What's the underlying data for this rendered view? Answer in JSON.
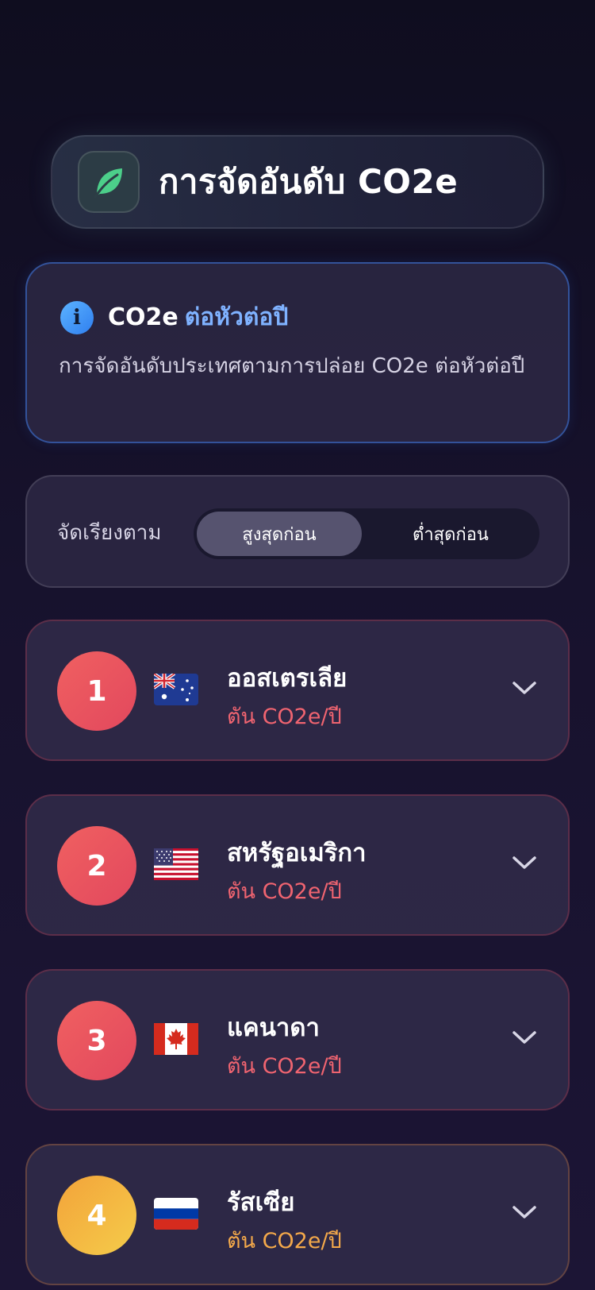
{
  "header": {
    "title": "การจัดอันดับ CO2e",
    "icon": "leaf-icon",
    "accent_color": "#4ccf8a"
  },
  "info": {
    "icon": "info-icon",
    "title_main": "CO2e",
    "title_sub": "ต่อหัวต่อปี",
    "description": "การจัดอันดับประเทศตามการปล่อย CO2e ต่อหัวต่อปี"
  },
  "sort": {
    "label": "จัดเรียงตาม",
    "options": [
      "สูงสุดก่อน",
      "ต่ำสุดก่อน"
    ],
    "selected": "สูงสุดก่อน"
  },
  "countries": [
    {
      "rank": "1",
      "name": "ออสเตรเลีย",
      "unit": "ตัน CO2e/ปี",
      "flag": "australia-flag",
      "color": "#ef5a64"
    },
    {
      "rank": "2",
      "name": "สหรัฐอเมริกา",
      "unit": "ตัน CO2e/ปี",
      "flag": "usa-flag",
      "color": "#ef5a64"
    },
    {
      "rank": "3",
      "name": "แคนาดา",
      "unit": "ตัน CO2e/ปี",
      "flag": "canada-flag",
      "color": "#ef5a64"
    },
    {
      "rank": "4",
      "name": "รัสเซีย",
      "unit": "ตัน CO2e/ปี",
      "flag": "russia-flag",
      "color": "#f4a94a"
    }
  ]
}
